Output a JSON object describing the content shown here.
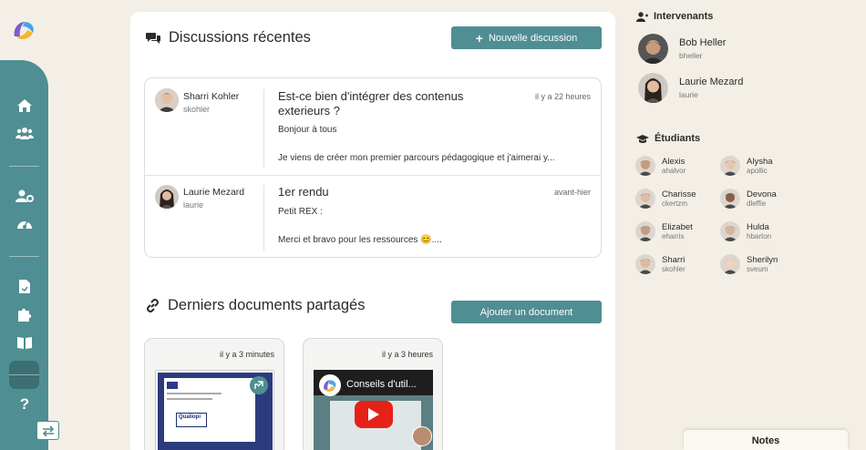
{
  "colors": {
    "accent": "#4f8e92",
    "background": "#f3efe6"
  },
  "sidebar": {
    "items": [
      {
        "icon": "home-icon"
      },
      {
        "icon": "users-icon"
      },
      {
        "icon": "user-settings-icon"
      },
      {
        "icon": "dashboard-icon"
      },
      {
        "icon": "document-icon"
      },
      {
        "icon": "puzzle-icon",
        "active": true
      },
      {
        "icon": "book-icon"
      },
      {
        "icon": "help-icon"
      }
    ],
    "swap_icon": "swap-icon"
  },
  "discussions": {
    "title": "Discussions récentes",
    "new_button": "Nouvelle discussion",
    "items": [
      {
        "author": "Sharri Kohler",
        "handle": "skohler",
        "title": "Est-ce bien d'intégrer des contenus exterieurs ?",
        "time": "il y a 22 heures",
        "line1": "Bonjour à tous",
        "line2": "Je viens de créer mon premier parcours pédagogique et j'aimerai y..."
      },
      {
        "author": "Laurie Mezard",
        "handle": "laurie",
        "title": "1er rendu",
        "time": "avant-hier",
        "line1": "Petit REX :",
        "line2": "Merci et bravo pour les ressources 😊...."
      }
    ]
  },
  "documents": {
    "title": "Derniers documents partagés",
    "add_button": "Ajouter un document",
    "items": [
      {
        "time": "il y a 3 minutes",
        "logo_text": "Qualiopi"
      },
      {
        "time": "il y a 3 heures",
        "video_title": "Conseils d'util..."
      }
    ]
  },
  "intervenants": {
    "title": "Intervenants",
    "people": [
      {
        "name": "Bob Heller",
        "handle": "bheller"
      },
      {
        "name": "Laurie Mezard",
        "handle": "laurie"
      }
    ]
  },
  "etudiants": {
    "title": "Étudiants",
    "people": [
      {
        "name": "Alexis",
        "handle": "ahalvor"
      },
      {
        "name": "Alysha",
        "handle": "apollic"
      },
      {
        "name": "Charisse",
        "handle": "ckertzm"
      },
      {
        "name": "Devona",
        "handle": "dleffie"
      },
      {
        "name": "Elizabet",
        "handle": "eharris"
      },
      {
        "name": "Hulda",
        "handle": "hbarton"
      },
      {
        "name": "Sharri",
        "handle": "skohler"
      },
      {
        "name": "Sherilyn",
        "handle": "sveum"
      }
    ]
  },
  "notes": {
    "label": "Notes"
  }
}
